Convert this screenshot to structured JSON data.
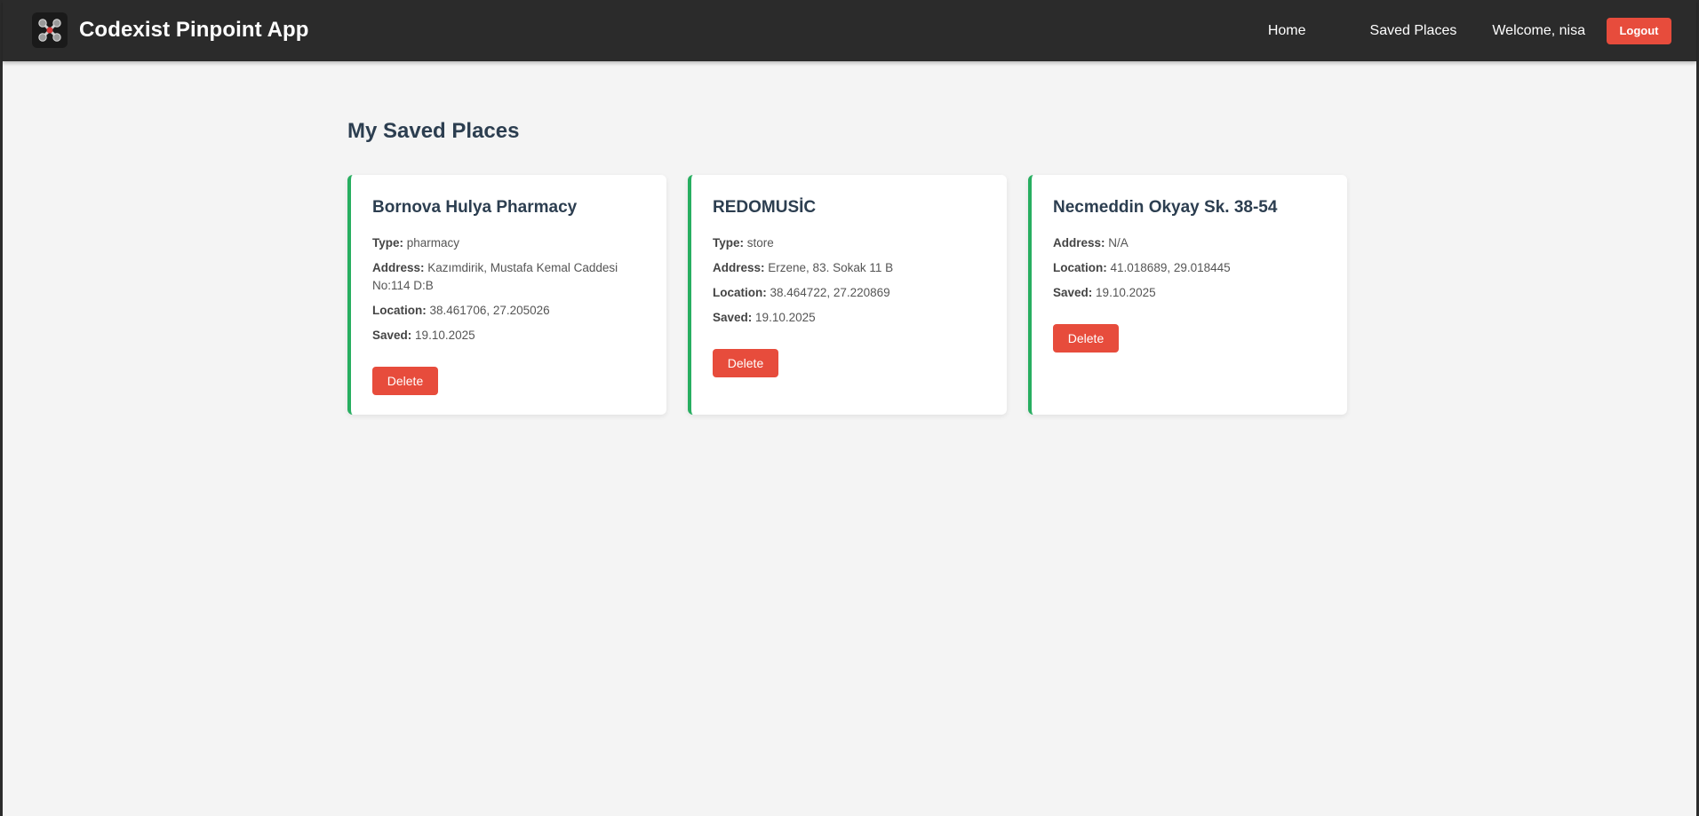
{
  "navbar": {
    "brand_title": "Codexist Pinpoint App",
    "logo_icon": "drone-icon",
    "home_label": "Home",
    "saved_places_label": "Saved Places",
    "welcome_text": "Welcome, nisa",
    "logout_label": "Logout"
  },
  "main": {
    "page_title": "My Saved Places",
    "labels": {
      "type": "Type:",
      "address": "Address:",
      "location": "Location:",
      "saved": "Saved:"
    },
    "delete_label": "Delete",
    "places": [
      {
        "name": "Bornova Hulya Pharmacy",
        "type": "pharmacy",
        "address": "Kazımdirik, Mustafa Kemal Caddesi No:114 D:B",
        "location": "38.461706, 27.205026",
        "saved": "19.10.2025"
      },
      {
        "name": "REDOMUSİC",
        "type": "store",
        "address": "Erzene, 83. Sokak 11 B",
        "location": "38.464722, 27.220869",
        "saved": "19.10.2025"
      },
      {
        "name": "Necmeddin Okyay Sk. 38-54",
        "address": "N/A",
        "location": "41.018689, 29.018445",
        "saved": "19.10.2025"
      }
    ]
  },
  "colors": {
    "navbar_bg": "#2b2b2b",
    "accent_red": "#e74c3c",
    "card_border_green": "#27ae60",
    "title_dark": "#2c3e50",
    "page_bg": "#f4f4f4"
  }
}
